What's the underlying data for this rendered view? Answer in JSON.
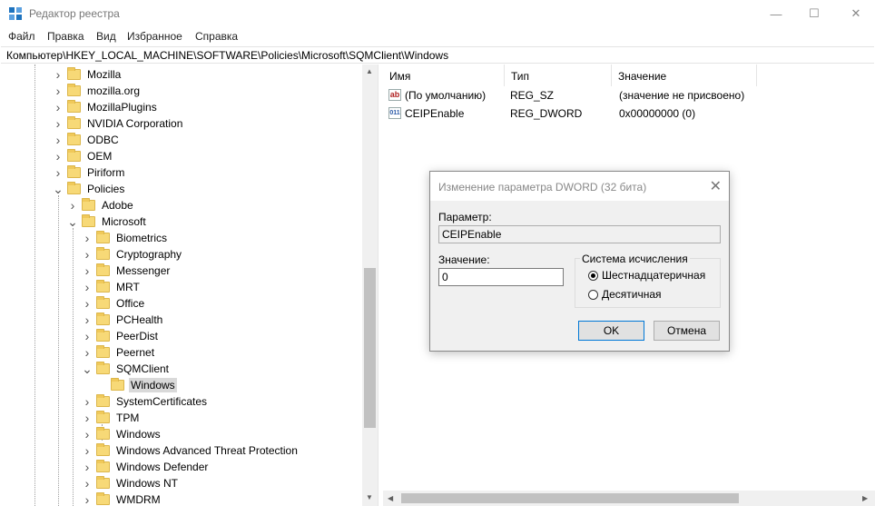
{
  "window": {
    "title": "Редактор реестра",
    "minimize": "—",
    "maximize": "☐",
    "close": "✕"
  },
  "menu": [
    "Файл",
    "Правка",
    "Вид",
    "Избранное",
    "Справка"
  ],
  "address": "Компьютер\\HKEY_LOCAL_MACHINE\\SOFTWARE\\Policies\\Microsoft\\SQMClient\\Windows",
  "tree": [
    {
      "label": "Mozilla",
      "expanded": false
    },
    {
      "label": "mozilla.org",
      "expanded": false
    },
    {
      "label": "MozillaPlugins",
      "expanded": false
    },
    {
      "label": "NVIDIA Corporation",
      "expanded": false
    },
    {
      "label": "ODBC",
      "expanded": false
    },
    {
      "label": "OEM",
      "expanded": false
    },
    {
      "label": "Piriform",
      "expanded": false
    },
    {
      "label": "Policies",
      "expanded": true
    },
    {
      "label": "Adobe",
      "expanded": false
    },
    {
      "label": "Microsoft",
      "expanded": true
    },
    {
      "label": "Biometrics",
      "expanded": false
    },
    {
      "label": "Cryptography",
      "expanded": false
    },
    {
      "label": "Messenger",
      "expanded": false
    },
    {
      "label": "MRT",
      "expanded": false
    },
    {
      "label": "Office",
      "expanded": false
    },
    {
      "label": "PCHealth",
      "expanded": false
    },
    {
      "label": "PeerDist",
      "expanded": false
    },
    {
      "label": "Peernet",
      "expanded": false
    },
    {
      "label": "SQMClient",
      "expanded": true
    },
    {
      "label": "Windows",
      "expanded": false,
      "selected": true
    },
    {
      "label": "SystemCertificates",
      "expanded": false
    },
    {
      "label": "TPM",
      "expanded": false
    },
    {
      "label": "Windows",
      "expanded": false
    },
    {
      "label": "Windows Advanced Threat Protection",
      "expanded": false
    },
    {
      "label": "Windows Defender",
      "expanded": false
    },
    {
      "label": "Windows NT",
      "expanded": false
    },
    {
      "label": "WMDRM",
      "expanded": false
    }
  ],
  "list": {
    "columns": [
      "Имя",
      "Тип",
      "Значение"
    ],
    "rows": [
      {
        "icon": "string-value-icon",
        "name": "(По умолчанию)",
        "type": "REG_SZ",
        "value": "(значение не присвоено)"
      },
      {
        "icon": "binary-value-icon",
        "name": "CEIPEnable",
        "type": "REG_DWORD",
        "value": "0x00000000 (0)"
      }
    ]
  },
  "dialog": {
    "title": "Изменение параметра DWORD (32 бита)",
    "param_label": "Параметр:",
    "param_value": "CEIPEnable",
    "value_label": "Значение:",
    "value": "0",
    "base_label": "Система исчисления",
    "base_options": [
      {
        "label": "Шестнадцатеричная",
        "checked": true
      },
      {
        "label": "Десятичная",
        "checked": false
      }
    ],
    "ok": "OK",
    "cancel": "Отмена"
  },
  "colors": {
    "folder": "#f7d977",
    "selection": "#d9d9d9",
    "dialog_bg": "#f0f0f0"
  }
}
